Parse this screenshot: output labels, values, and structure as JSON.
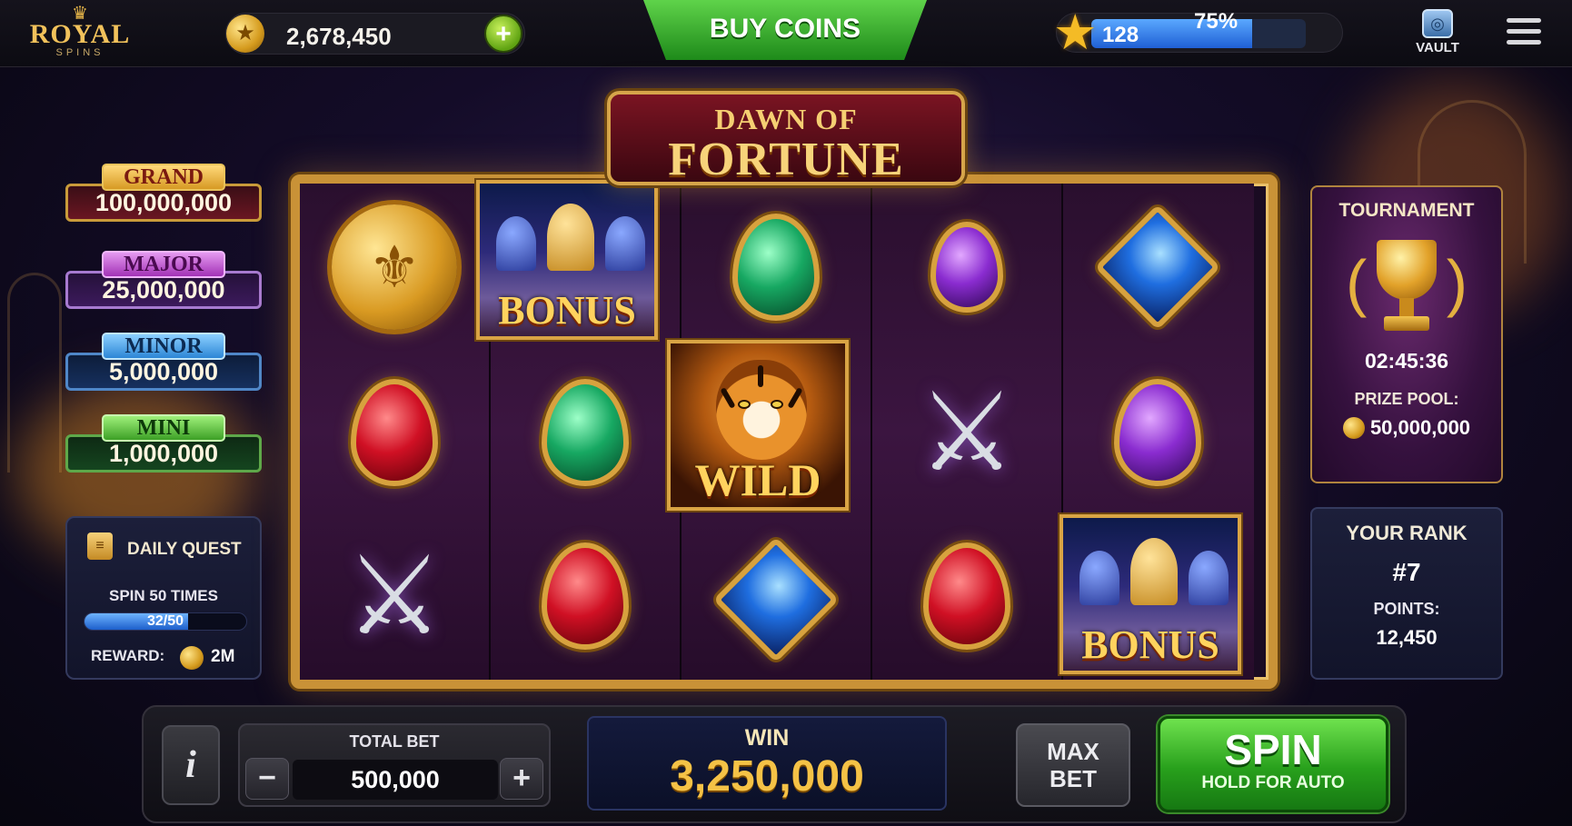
{
  "header": {
    "logo_top": "ROYAL",
    "logo_bottom": "SPINS",
    "coin_balance": "2,678,450",
    "add_coins_symbol": "+",
    "buy_coins_label": "BUY COINS",
    "level": "128",
    "level_progress_text": "75%",
    "level_progress": 0.75,
    "vault_label": "VAULT",
    "icons": [
      "crown-icon",
      "coin-icon",
      "plus-icon",
      "star-icon",
      "vault-icon",
      "hamburger-menu-icon"
    ]
  },
  "jackpots": [
    {
      "name": "GRAND",
      "value": "100,000,000",
      "color": "#d79a24"
    },
    {
      "name": "MAJOR",
      "value": "25,000,000",
      "color": "#a232b6"
    },
    {
      "name": "MINOR",
      "value": "5,000,000",
      "color": "#2c86d6"
    },
    {
      "name": "MINI",
      "value": "1,000,000",
      "color": "#3da026"
    }
  ],
  "daily_quest": {
    "title": "DAILY QUEST",
    "task": "SPIN 50 TIMES",
    "progress_text": "32/50",
    "progress": 0.64,
    "reward_label": "REWARD:",
    "reward_value": "2M"
  },
  "game": {
    "title_top": "DAWN OF",
    "title_bottom": "FORTUNE",
    "reels": [
      [
        "gold-coin",
        "red-gem",
        "crossed-swords"
      ],
      [
        "bonus",
        "green-gem",
        "red-gem"
      ],
      [
        "green-gem",
        "wild-tiger",
        "blue-gem"
      ],
      [
        "purple-gem",
        "crossed-swords",
        "red-gem"
      ],
      [
        "blue-gem",
        "purple-gem",
        "bonus"
      ]
    ],
    "bonus_label": "BONUS",
    "wild_label": "WILD"
  },
  "tournament": {
    "title": "TOURNAMENT",
    "timer": "02:45:36",
    "prize_pool_label": "PRIZE POOL:",
    "prize_pool": "50,000,000"
  },
  "rank": {
    "title": "YOUR RANK",
    "position": "#7",
    "points_label": "POINTS:",
    "points": "12,450"
  },
  "controls": {
    "info_label": "i",
    "total_bet_label": "TOTAL BET",
    "total_bet": "500,000",
    "minus_label": "−",
    "plus_label": "+",
    "win_label": "WIN",
    "win_value": "3,250,000",
    "max_bet_line1": "MAX",
    "max_bet_line2": "BET",
    "spin_label": "SPIN",
    "spin_sub": "HOLD FOR AUTO"
  },
  "colors": {
    "accent_gold": "#f5c246",
    "spin_green": "#28a01c",
    "level_blue": "#1f5fd4"
  }
}
